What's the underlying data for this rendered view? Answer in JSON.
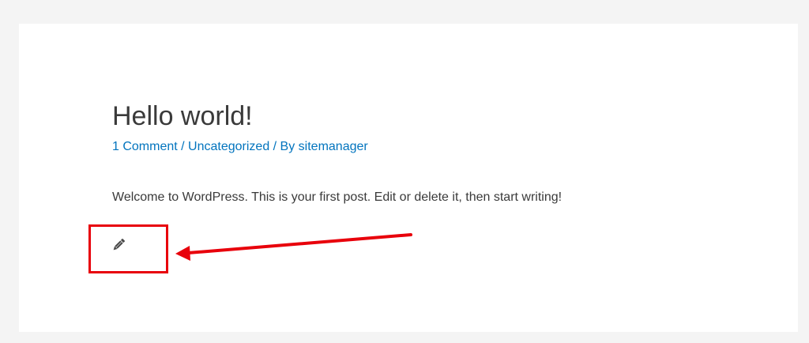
{
  "post": {
    "title": "Hello world!",
    "meta": {
      "comments": "1 Comment",
      "separator1": " / ",
      "category": "Uncategorized",
      "separator2": " / By ",
      "author": "sitemanager"
    },
    "body": "Welcome to WordPress. This is your first post. Edit or delete it, then start writing!",
    "edit_icon": "pencil-icon"
  },
  "annotation": {
    "color": "#e8000b"
  },
  "colors": {
    "link": "#0274be",
    "text": "#3a3a3a",
    "page_background": "#f4f4f4",
    "card_background": "#ffffff"
  }
}
